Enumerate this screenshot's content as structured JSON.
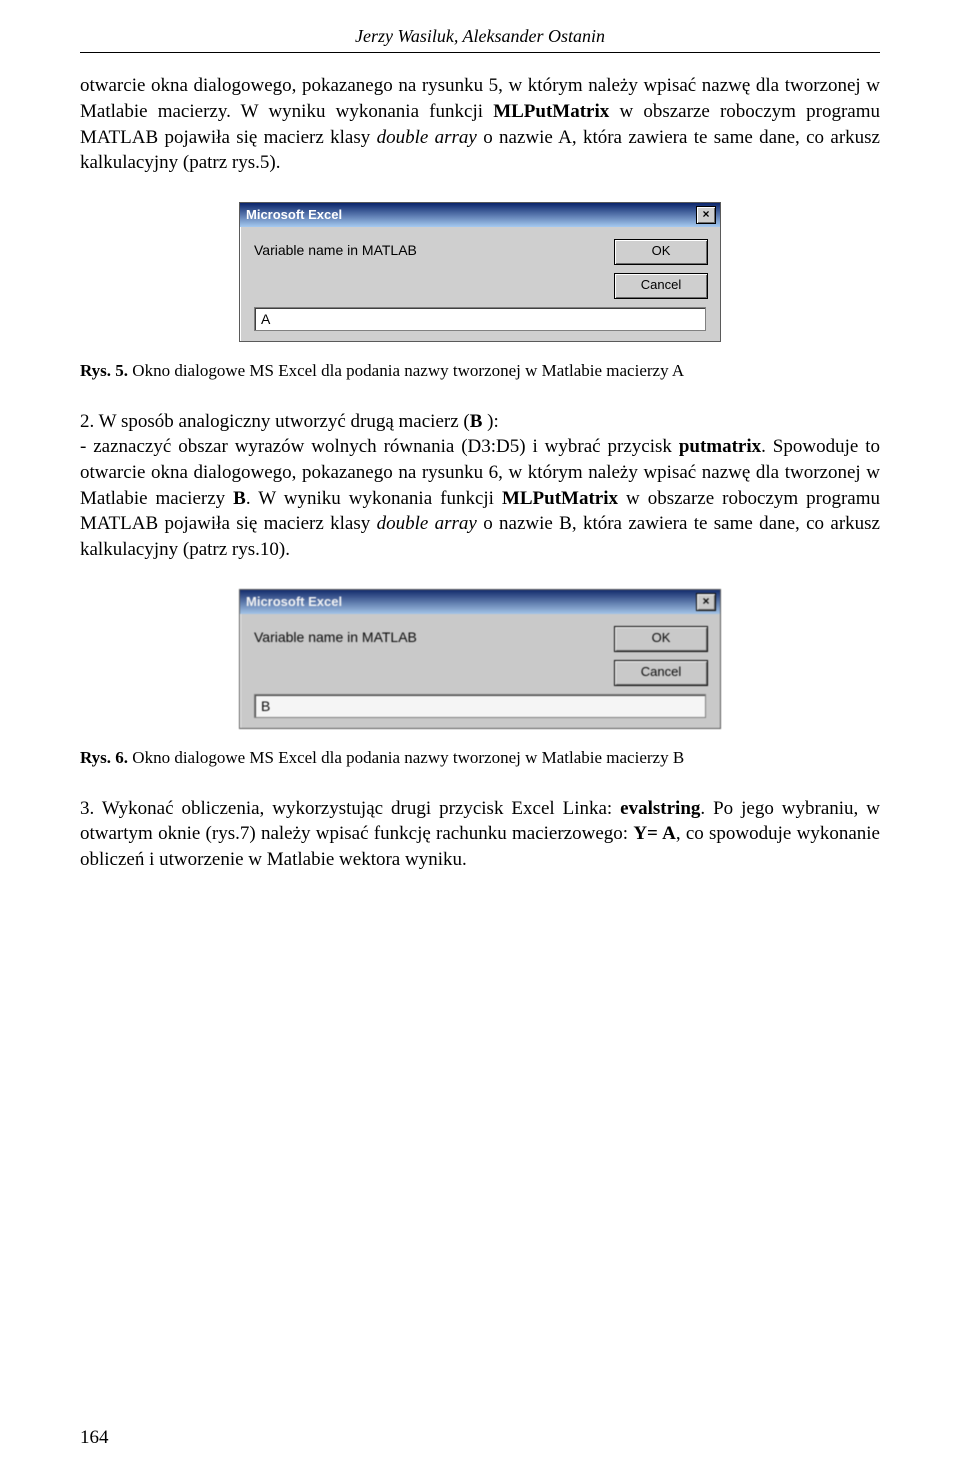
{
  "header": {
    "authors": "Jerzy Wasiluk, Aleksander Ostanin"
  },
  "para1_a": "otwarcie okna dialogowego, pokazanego na rysunku 5, w którym należy wpisać nazwę dla tworzonej w Matlabie macierzy. W wyniku wykonania funkcji ",
  "para1_b": "MLPutMatrix",
  "para1_c": " w obszarze roboczym programu MATLAB pojawiła się macierz klasy ",
  "para1_d": "double array",
  "para1_e": " o nazwie A, która zawiera te same dane, co arkusz kalkulacyjny (patrz rys.5).",
  "dialog1": {
    "title": "Microsoft Excel",
    "label": "Variable name in MATLAB",
    "ok": "OK",
    "cancel": "Cancel",
    "value": "A"
  },
  "caption1_a": "Rys. 5. ",
  "caption1_b": "Okno dialogowe MS Excel dla podania nazwy tworzonej w Matlabie macierzy A",
  "para2_a": "2. W sposób analogiczny utworzyć drugą macierz (",
  "para2_b": "B",
  "para2_c": " ):",
  "para2_d": "- zaznaczyć obszar wyrazów wolnych równania (D3:D5) i wybrać przycisk ",
  "para2_e": "putmatrix",
  "para2_f": ". Spowoduje to otwarcie okna dialogowego, pokazanego na rysunku 6, w którym należy wpisać nazwę dla tworzonej w Matlabie macierzy ",
  "para2_g": "B",
  "para2_h": ". W wyniku wykonania funkcji ",
  "para2_i": "MLPutMatrix",
  "para2_j": " w obszarze roboczym programu MATLAB pojawiła się macierz klasy ",
  "para2_k": "double array",
  "para2_l": " o nazwie B, która zawiera te same dane, co arkusz kalkulacyjny (patrz rys.10).",
  "dialog2": {
    "title": "Microsoft Excel",
    "label": "Variable name in MATLAB",
    "ok": "OK",
    "cancel": "Cancel",
    "value": "B"
  },
  "caption2_a": "Rys. 6. ",
  "caption2_b": "Okno dialogowe MS Excel dla podania nazwy tworzonej w Matlabie macierzy B",
  "para3_a": "3. Wykonać obliczenia, wykorzystując drugi przycisk Excel Linka: ",
  "para3_b": "evalstring",
  "para3_c": ". Po jego wybraniu, w otwartym oknie (rys.7) należy wpisać funkcję rachunku macierzowego: ",
  "para3_d": "Y= A",
  "para3_e": ", co spowoduje wykonanie obliczeń i utworzenie w Matlabie wektora wyniku.",
  "page_number": "164"
}
